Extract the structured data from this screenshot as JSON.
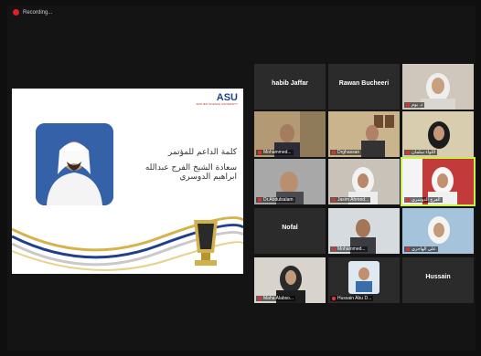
{
  "recording": {
    "label": "Recording..."
  },
  "slide": {
    "logo": "ASU",
    "logo_sub": "APPLIED SCIENCE UNIVERSITY",
    "line1": "كلمة الداعم للمؤتمر",
    "line2": "سعادة الشيخ الفرج عبدالله ابراهيم الدوسري"
  },
  "participants": [
    {
      "label": "habib Jaffar",
      "show": "name"
    },
    {
      "label": "Rawan Bucheeri",
      "show": "name"
    },
    {
      "label": "د. بوم",
      "show": "video"
    },
    {
      "label": "Mohammed...",
      "show": "video"
    },
    {
      "label": "Drghassan",
      "show": "video"
    },
    {
      "label": "اللواء سلمان",
      "show": "video"
    },
    {
      "label": "Dr.Abdulsalam",
      "show": "video"
    },
    {
      "label": "Jasim Ahmed...",
      "show": "video"
    },
    {
      "label": "الفرج الدوسري",
      "show": "video"
    },
    {
      "label": "Nofal",
      "show": "name"
    },
    {
      "label": "Mohammed...",
      "show": "video"
    },
    {
      "label": "علي الهاجري",
      "show": "video"
    },
    {
      "label": "Maha Alabso...",
      "show": "video"
    },
    {
      "label": "Hussain Abu D...",
      "show": "video"
    },
    {
      "label": "Hussain",
      "show": "name"
    }
  ]
}
